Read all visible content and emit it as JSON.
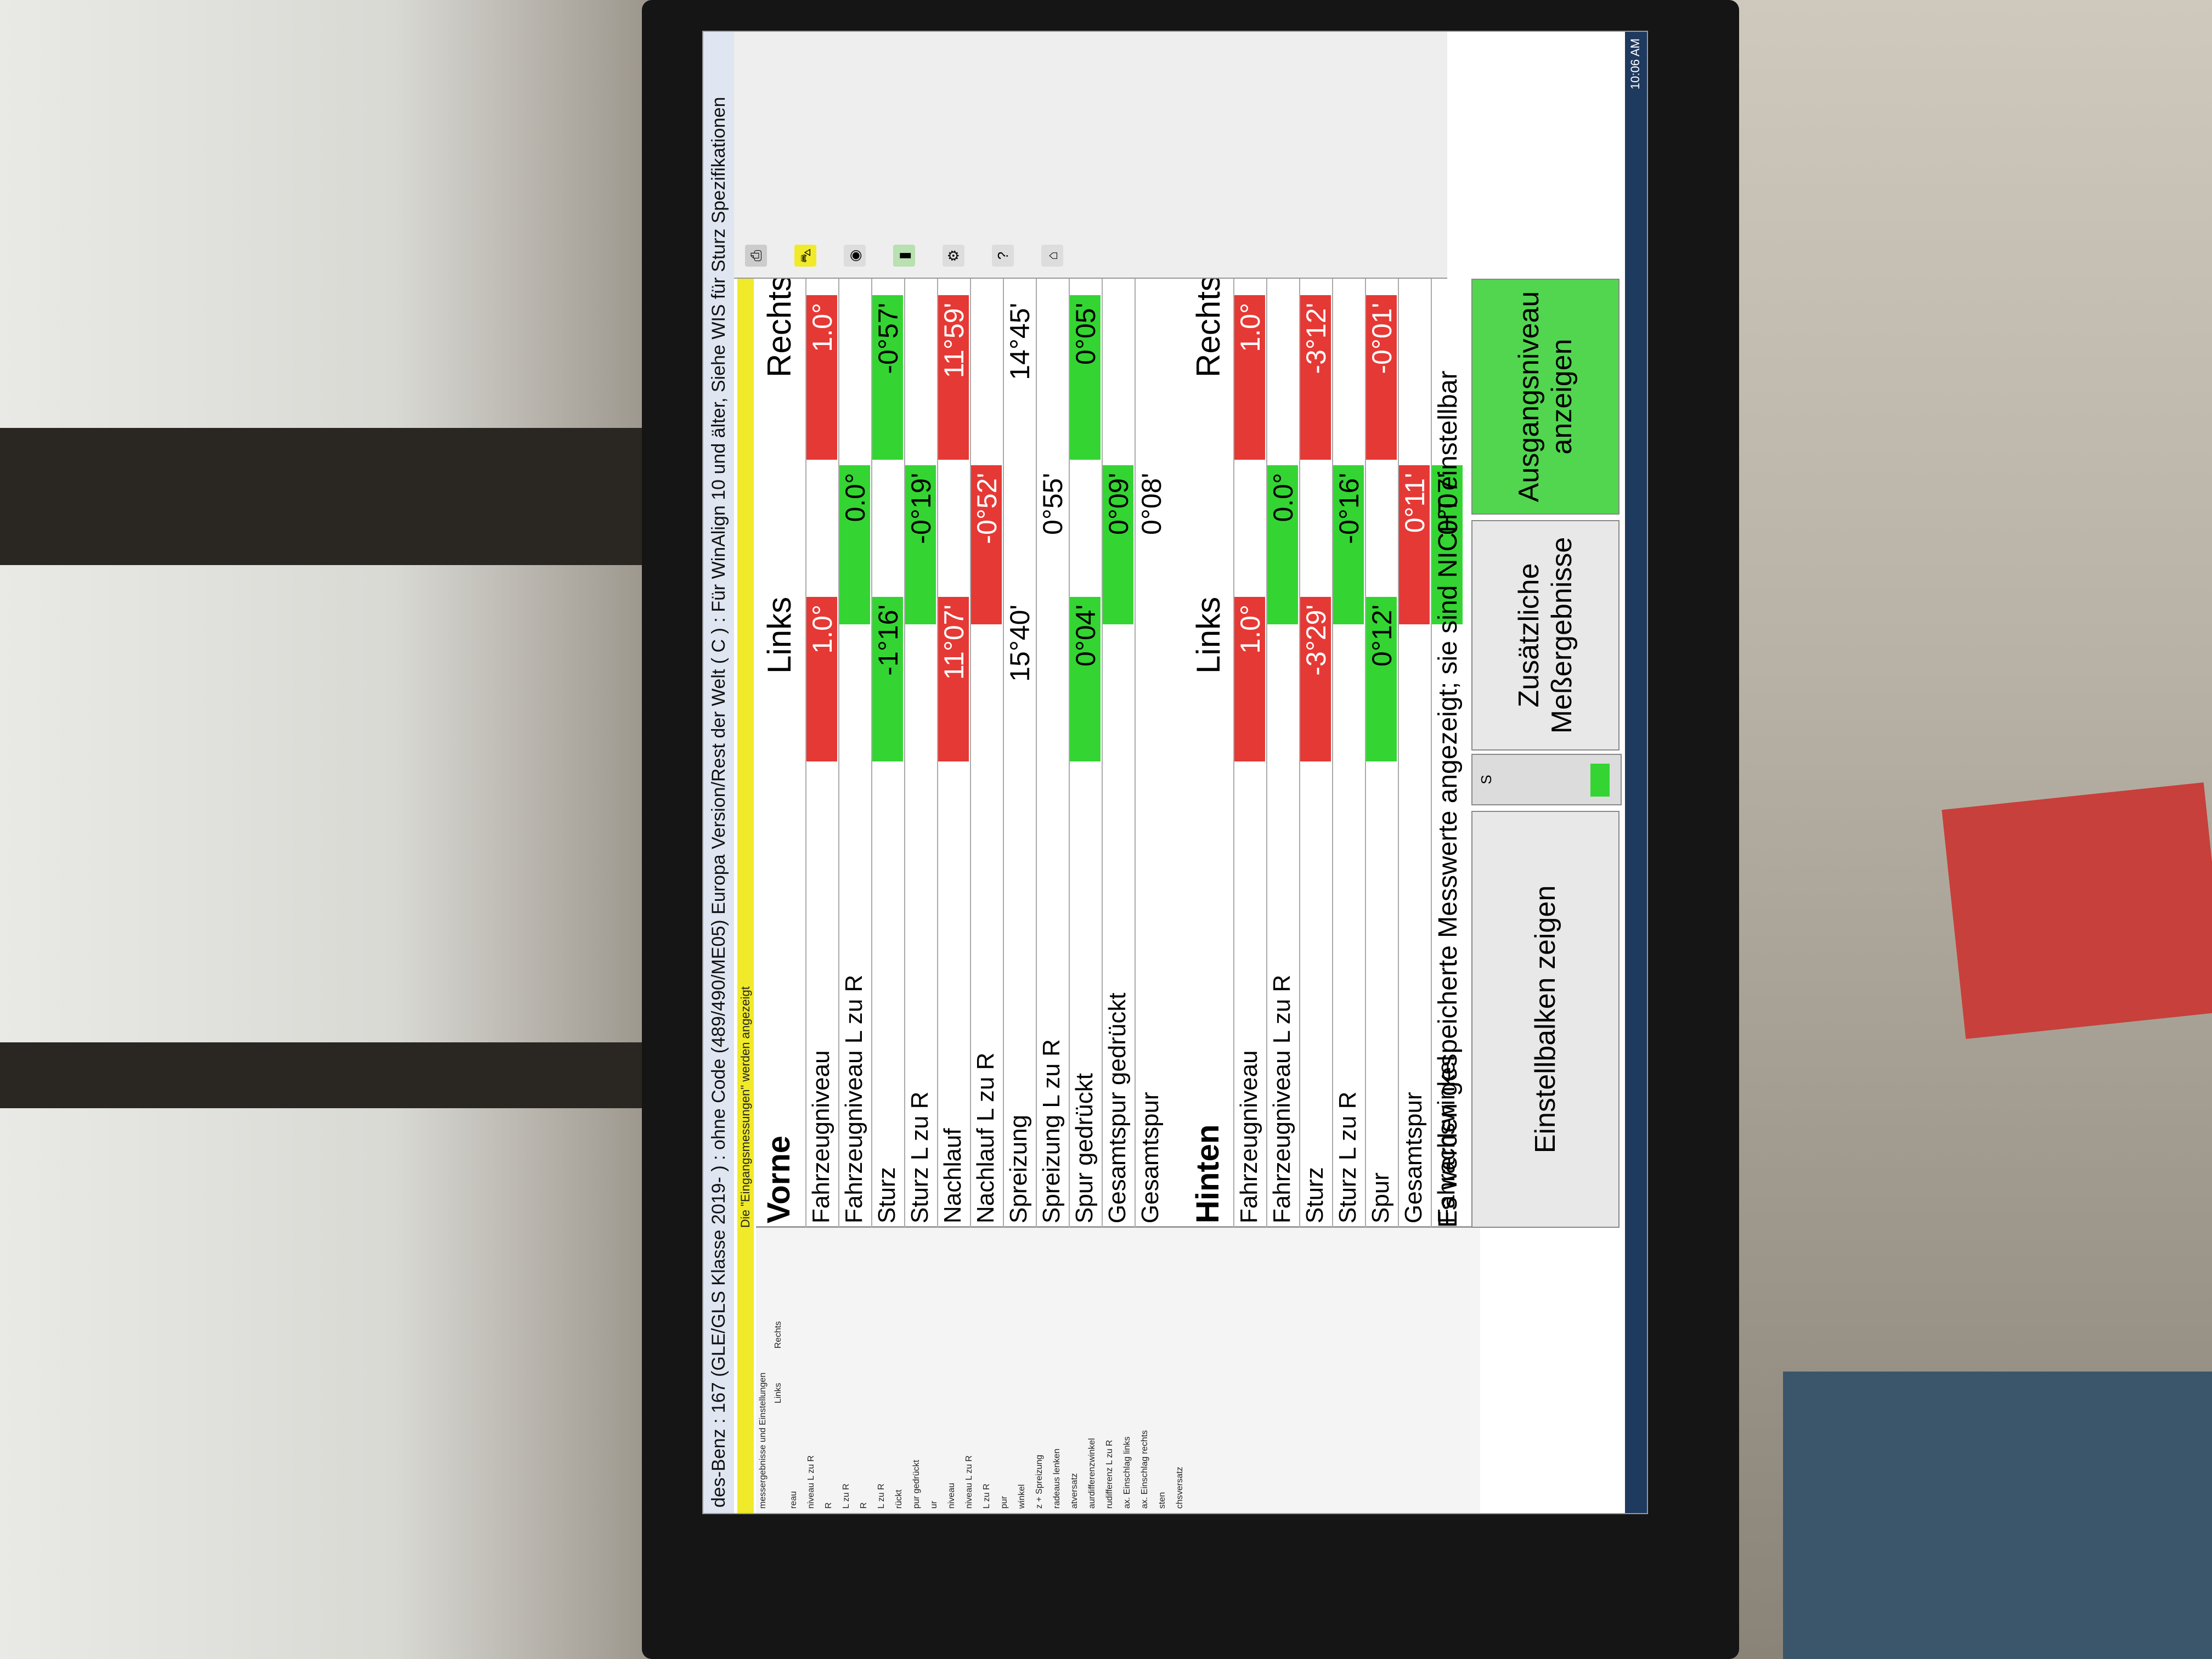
{
  "title_bar": "des-Benz : 167 (GLE/GLS Klasse 2019- ) : ohne Code (489/490/ME05) Europa Version/Rest der Welt ( C ) : Für WinAlign 10 und älter, Siehe WIS für Sturz Spezifikationen",
  "notice_bar": "Die \"Eingangsmessungen\" werden angezeigt",
  "left_panel": {
    "header": "messergebnisse und Einstellungen",
    "col_links": "Links",
    "col_rechts": "Rechts",
    "rows": [
      "reau",
      "niveau L zu R",
      "R",
      "L zu R",
      "R",
      "L zu R",
      "rückt",
      "pur gedrückt",
      "ur",
      "niveau",
      "niveau L zu R",
      "L zu R",
      "pur",
      "winkel",
      "z + Spreizung",
      "radeaus lenken",
      "atversatz",
      "aurdifferenzwinkel",
      "rudifferenz L zu R",
      "ax. Einschlag links",
      "ax. Einschlag rechts",
      "sten",
      "chsversatz"
    ]
  },
  "front": {
    "section": "Vorne",
    "col_left": "Links",
    "col_right": "Rechts",
    "rows": [
      {
        "label": "Fahrzeugniveau",
        "left": "1.0°",
        "left_status": "red",
        "mid": "",
        "mid_status": "",
        "right": "1.0°",
        "right_status": "red"
      },
      {
        "label": "Fahrzeugniveau L zu R",
        "left": "",
        "left_status": "",
        "mid": "0.0°",
        "mid_status": "green",
        "right": "",
        "right_status": ""
      },
      {
        "label": "Sturz",
        "left": "-1°16'",
        "left_status": "green",
        "mid": "",
        "mid_status": "",
        "right": "-0°57'",
        "right_status": "green"
      },
      {
        "label": "Sturz  L zu R",
        "left": "",
        "left_status": "",
        "mid": "-0°19'",
        "mid_status": "green",
        "right": "",
        "right_status": ""
      },
      {
        "label": "Nachlauf",
        "left": "11°07'",
        "left_status": "red",
        "mid": "",
        "mid_status": "",
        "right": "11°59'",
        "right_status": "red"
      },
      {
        "label": "Nachlauf  L zu R",
        "left": "",
        "left_status": "",
        "mid": "-0°52'",
        "mid_status": "red",
        "right": "",
        "right_status": ""
      },
      {
        "label": "Spreizung",
        "left": "15°40'",
        "left_status": "",
        "mid": "",
        "mid_status": "",
        "right": "14°45'",
        "right_status": ""
      },
      {
        "label": "Spreizung L zu R",
        "left": "",
        "left_status": "",
        "mid": "0°55'",
        "mid_status": "",
        "right": "",
        "right_status": ""
      },
      {
        "label": "Spur gedrückt",
        "left": "0°04'",
        "left_status": "green",
        "mid": "",
        "mid_status": "",
        "right": "0°05'",
        "right_status": "green"
      },
      {
        "label": "Gesamtspur gedrückt",
        "left": "",
        "left_status": "",
        "mid": "0°09'",
        "mid_status": "green",
        "right": "",
        "right_status": ""
      },
      {
        "label": "Gesamtspur",
        "left": "",
        "left_status": "",
        "mid": "0°08'",
        "mid_status": "",
        "right": "",
        "right_status": ""
      }
    ]
  },
  "rear": {
    "section": "Hinten",
    "col_left": "Links",
    "col_right": "Rechts",
    "rows": [
      {
        "label": "Fahrzeugniveau",
        "left": "1.0°",
        "left_status": "red",
        "mid": "",
        "mid_status": "",
        "right": "1.0°",
        "right_status": "red"
      },
      {
        "label": "Fahrzeugniveau L zu R",
        "left": "",
        "left_status": "",
        "mid": "0.0°",
        "mid_status": "green",
        "right": "",
        "right_status": ""
      },
      {
        "label": "Sturz",
        "left": "-3°29'",
        "left_status": "red",
        "mid": "",
        "mid_status": "",
        "right": "-3°12'",
        "right_status": "red"
      },
      {
        "label": "Sturz  L zu R",
        "left": "",
        "left_status": "",
        "mid": "-0°16'",
        "mid_status": "green",
        "right": "",
        "right_status": ""
      },
      {
        "label": "Spur",
        "left": "0°12'",
        "left_status": "green",
        "mid": "",
        "mid_status": "",
        "right": "-0°01'",
        "right_status": "red"
      },
      {
        "label": "Gesamtspur",
        "left": "",
        "left_status": "",
        "mid": "0°11'",
        "mid_status": "red",
        "right": "",
        "right_status": ""
      },
      {
        "label": "Fahrachswinkel",
        "left": "",
        "left_status": "",
        "mid": "0°07'",
        "mid_status": "green",
        "right": "",
        "right_status": ""
      }
    ]
  },
  "bottom_message": "Es werden gespeicherte Messwerte angezeigt; sie sind NICHT einstellbar",
  "buttons": {
    "adjust_bars": "Einstellbalken zeigen",
    "additional": "Zusätzliche Meßergebnisse",
    "initial_level": "Ausgangsniveau anzeigen"
  },
  "progress": {
    "label": "S",
    "fraction": 0.15
  },
  "clock": "10:06 AM",
  "colors": {
    "red": "#e53935",
    "green": "#34d433",
    "yellow": "#f0ea2a"
  },
  "toolbar_icons": [
    "printer-icon",
    "vehicle-icon",
    "sensor-icon",
    "battery-icon",
    "settings-icon",
    "help-icon",
    "home-icon"
  ]
}
